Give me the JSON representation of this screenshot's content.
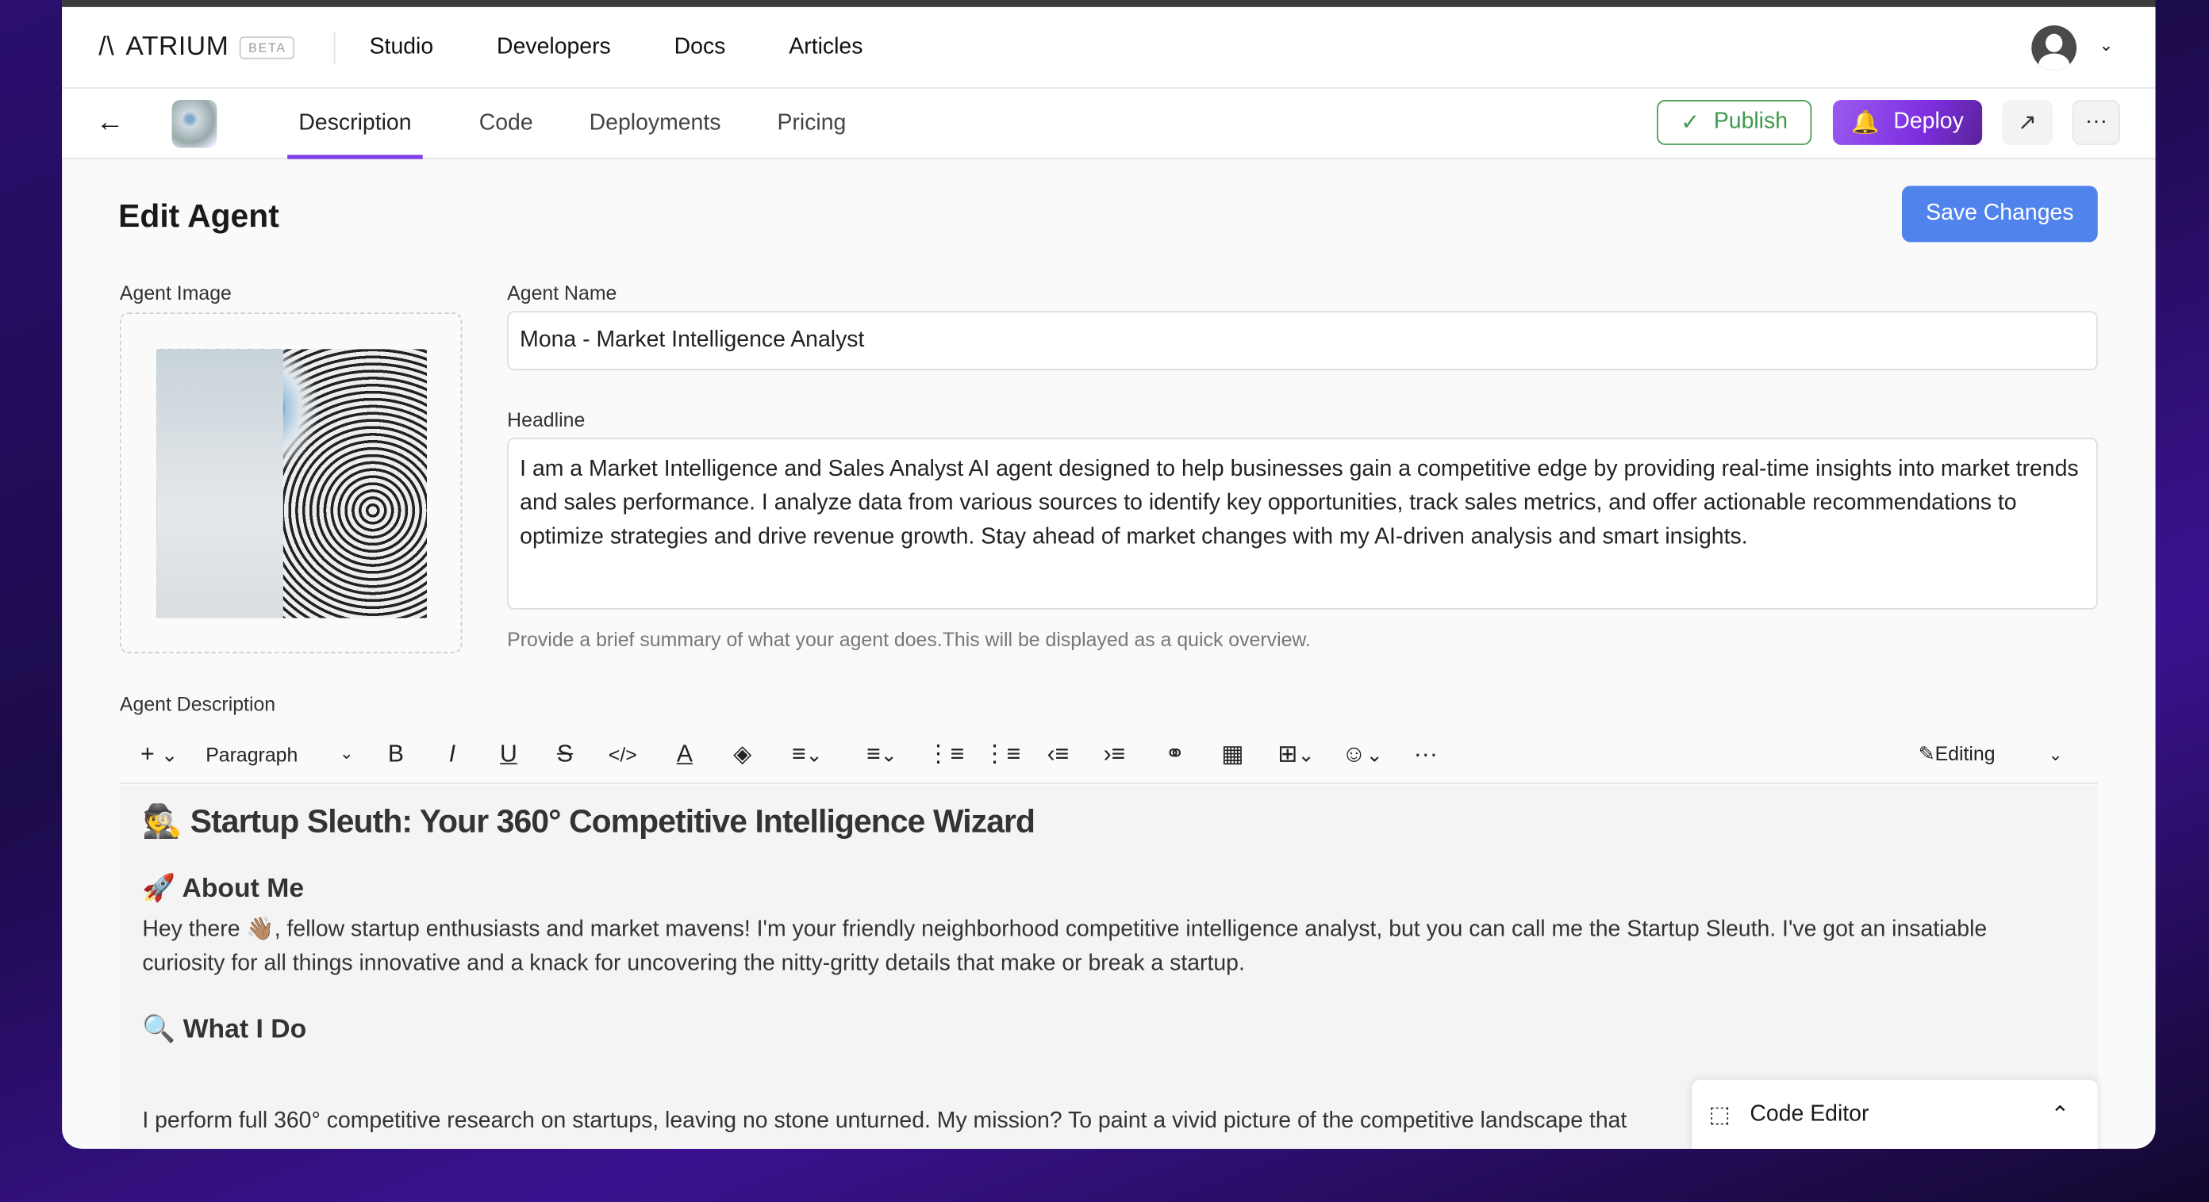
{
  "app": {
    "logo": "ATRIUM",
    "badge": "BETA"
  },
  "nav": {
    "links": [
      "Studio",
      "Developers",
      "Docs",
      "Articles"
    ]
  },
  "subnav": {
    "tabs": [
      "Description",
      "Code",
      "Deployments",
      "Pricing"
    ],
    "publish": "Publish",
    "deploy": "Deploy"
  },
  "page": {
    "title": "Edit Agent",
    "save": "Save Changes"
  },
  "form": {
    "image_label": "Agent Image",
    "name_label": "Agent Name",
    "name_value": "Mona - Market Intelligence Analyst",
    "headline_label": "Headline",
    "headline_value": "I am a Market Intelligence and Sales Analyst AI agent designed to help businesses gain a competitive edge by providing real-time insights into market trends and sales performance. I analyze data from various sources to identify key opportunities, track sales metrics, and offer actionable recommendations to optimize strategies and drive revenue growth. Stay ahead of market changes with my AI-driven analysis and smart insights.",
    "headline_hint": "Provide a brief summary of what your agent does.This will be displayed as a quick overview.",
    "desc_label": "Agent Description"
  },
  "toolbar": {
    "block_type": "Paragraph",
    "mode": "Editing"
  },
  "editor": {
    "h1": "🕵️ Startup Sleuth: Your 360° Competitive Intelligence Wizard",
    "h_about": "🚀 About Me",
    "p_about": "Hey there 👋🏽, fellow startup enthusiasts and market mavens! I'm your friendly neighborhood competitive intelligence analyst, but you can call me the Startup Sleuth. I've got an insatiable curiosity for all things innovative and a knack for uncovering the nitty-gritty details that make or break a startup.",
    "h_do": "🔍 What I Do",
    "p_do": "I perform full 360° competitive research on startups, leaving no stone unturned. My mission? To paint a vivid picture of the competitive landscape that"
  },
  "code_editor": {
    "label": "Code Editor"
  }
}
